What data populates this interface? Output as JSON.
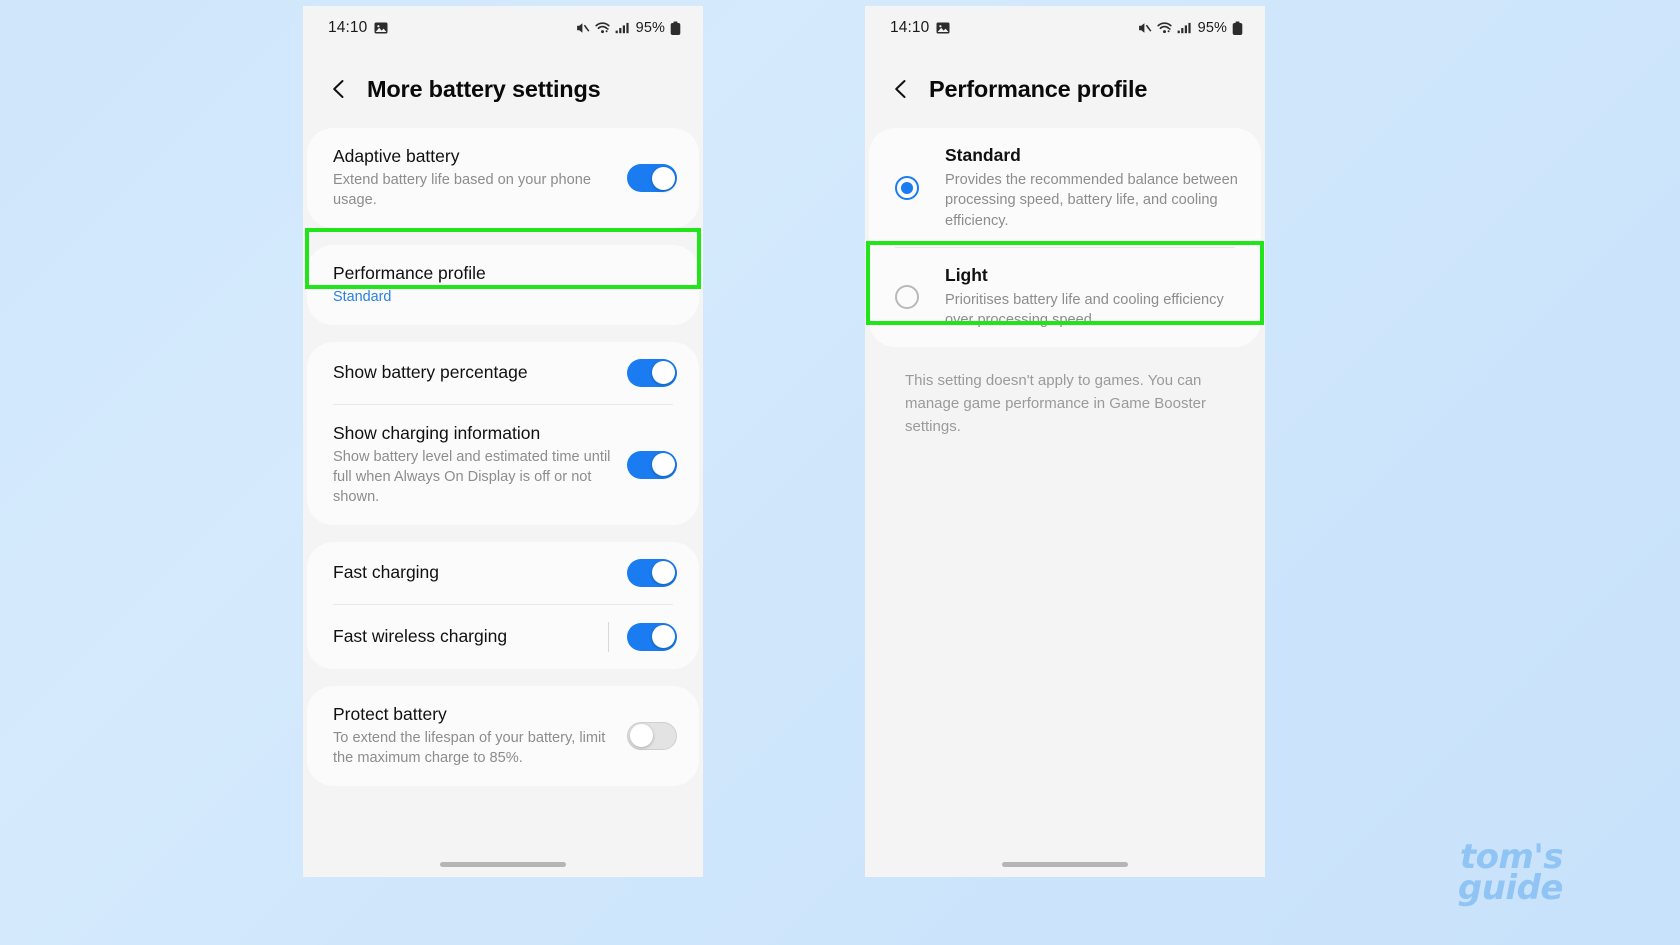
{
  "background_color": "#cfe6fb",
  "highlight_color": "#21e51a",
  "accent_color": "#1a7cf0",
  "watermark": {
    "line1": "tom's",
    "line2": "guide"
  },
  "statusbar": {
    "time": "14:10",
    "battery_percent": "95%",
    "icons": [
      "image-icon",
      "mute-icon",
      "wifi-icon",
      "signal-icon",
      "battery-icon"
    ]
  },
  "left_screen": {
    "header": {
      "title": "More battery settings",
      "back": "back-chevron"
    },
    "groups": [
      {
        "rows": [
          {
            "title": "Adaptive battery",
            "subtitle": "Extend battery life based on your phone usage.",
            "control": "toggle",
            "state": "on"
          }
        ]
      },
      {
        "highlighted": true,
        "rows": [
          {
            "title": "Performance profile",
            "subtitle": "Standard",
            "subtitle_style": "accent",
            "control": "none"
          }
        ]
      },
      {
        "rows": [
          {
            "title": "Show battery percentage",
            "subtitle": "",
            "control": "toggle",
            "state": "on"
          },
          {
            "title": "Show charging information",
            "subtitle": "Show battery level and estimated time until full when Always On Display is off or not shown.",
            "control": "toggle",
            "state": "on"
          }
        ]
      },
      {
        "rows": [
          {
            "title": "Fast charging",
            "subtitle": "",
            "control": "toggle",
            "state": "on"
          },
          {
            "title": "Fast wireless charging",
            "subtitle": "",
            "control": "toggle",
            "state": "on",
            "vertical_divider": true
          }
        ]
      },
      {
        "rows": [
          {
            "title": "Protect battery",
            "subtitle": "To extend the lifespan of your battery, limit the maximum charge to 85%.",
            "control": "toggle",
            "state": "off"
          }
        ]
      }
    ]
  },
  "right_screen": {
    "header": {
      "title": "Performance profile",
      "back": "back-chevron"
    },
    "options": [
      {
        "title": "Standard",
        "subtitle": "Provides the recommended balance between processing speed, battery life, and cooling efficiency.",
        "selected": true
      },
      {
        "title": "Light",
        "subtitle": "Prioritises battery life and cooling efficiency over processing speed.",
        "selected": false,
        "highlighted": true
      }
    ],
    "footnote": "This setting doesn't apply to games. You can manage game performance in Game Booster settings."
  }
}
